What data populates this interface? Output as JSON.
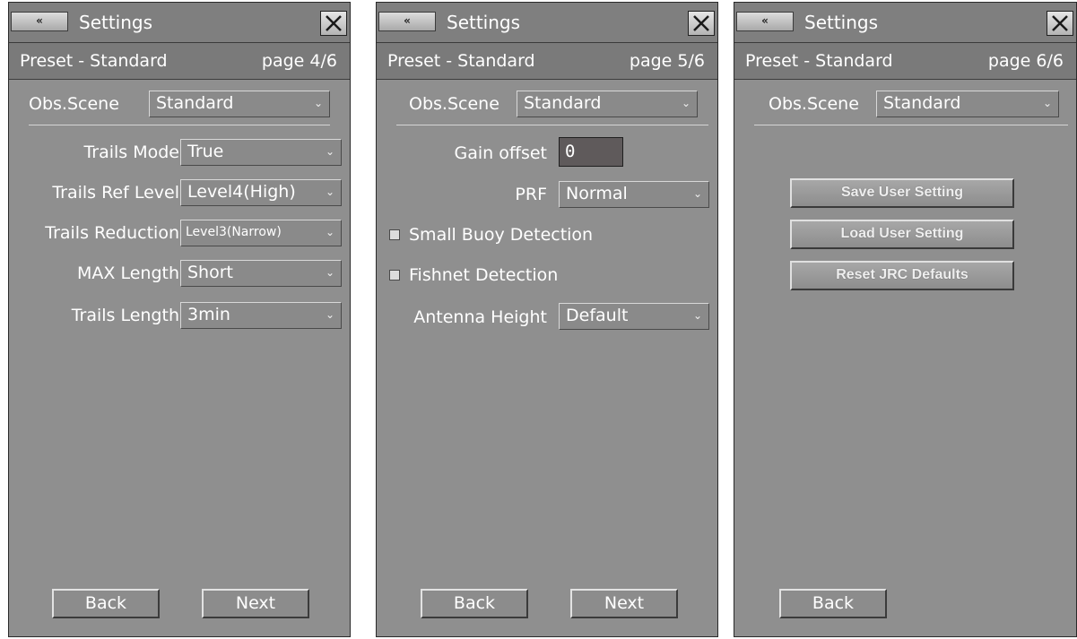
{
  "panels": [
    {
      "title": "Settings",
      "back_icon": "«",
      "preset": "Preset - Standard",
      "page": "page 4/6",
      "obs_scene_label": "Obs.Scene",
      "obs_scene_value": "Standard",
      "fields": [
        {
          "label": "Trails Mode",
          "value": "True"
        },
        {
          "label": "Trails Ref Level",
          "value": "Level4(High)"
        },
        {
          "label": "Trails Reduction",
          "value": "Level3(Narrow)"
        },
        {
          "label": "MAX Length",
          "value": "Short"
        },
        {
          "label": "Trails Length",
          "value": "3min"
        }
      ],
      "back_label": "Back",
      "next_label": "Next"
    },
    {
      "title": "Settings",
      "back_icon": "«",
      "preset": "Preset - Standard",
      "page": "page 5/6",
      "obs_scene_label": "Obs.Scene",
      "obs_scene_value": "Standard",
      "gain_offset_label": "Gain offset",
      "gain_offset_value": "0",
      "prf_label": "PRF",
      "prf_value": "Normal",
      "small_buoy_label": "Small Buoy Detection",
      "fishnet_label": "Fishnet Detection",
      "antenna_label": "Antenna Height",
      "antenna_value": "Default",
      "back_label": "Back",
      "next_label": "Next"
    },
    {
      "title": "Settings",
      "back_icon": "«",
      "preset": "Preset - Standard",
      "page": "page 6/6",
      "obs_scene_label": "Obs.Scene",
      "obs_scene_value": "Standard",
      "save_label": "Save User Setting",
      "load_label": "Load User Setting",
      "reset_label": "Reset JRC Defaults",
      "back_label": "Back"
    }
  ],
  "icons": {
    "close": "close-icon",
    "caret": "chevron-down-icon",
    "back": "double-left-chevron-icon",
    "checkbox": "checkbox-unchecked-icon"
  },
  "colors": {
    "panel_bg": "#8f8f8f",
    "header_bg": "#7f7f7f",
    "text": "#ffffff",
    "numbox_bg": "#5f5a5b"
  }
}
